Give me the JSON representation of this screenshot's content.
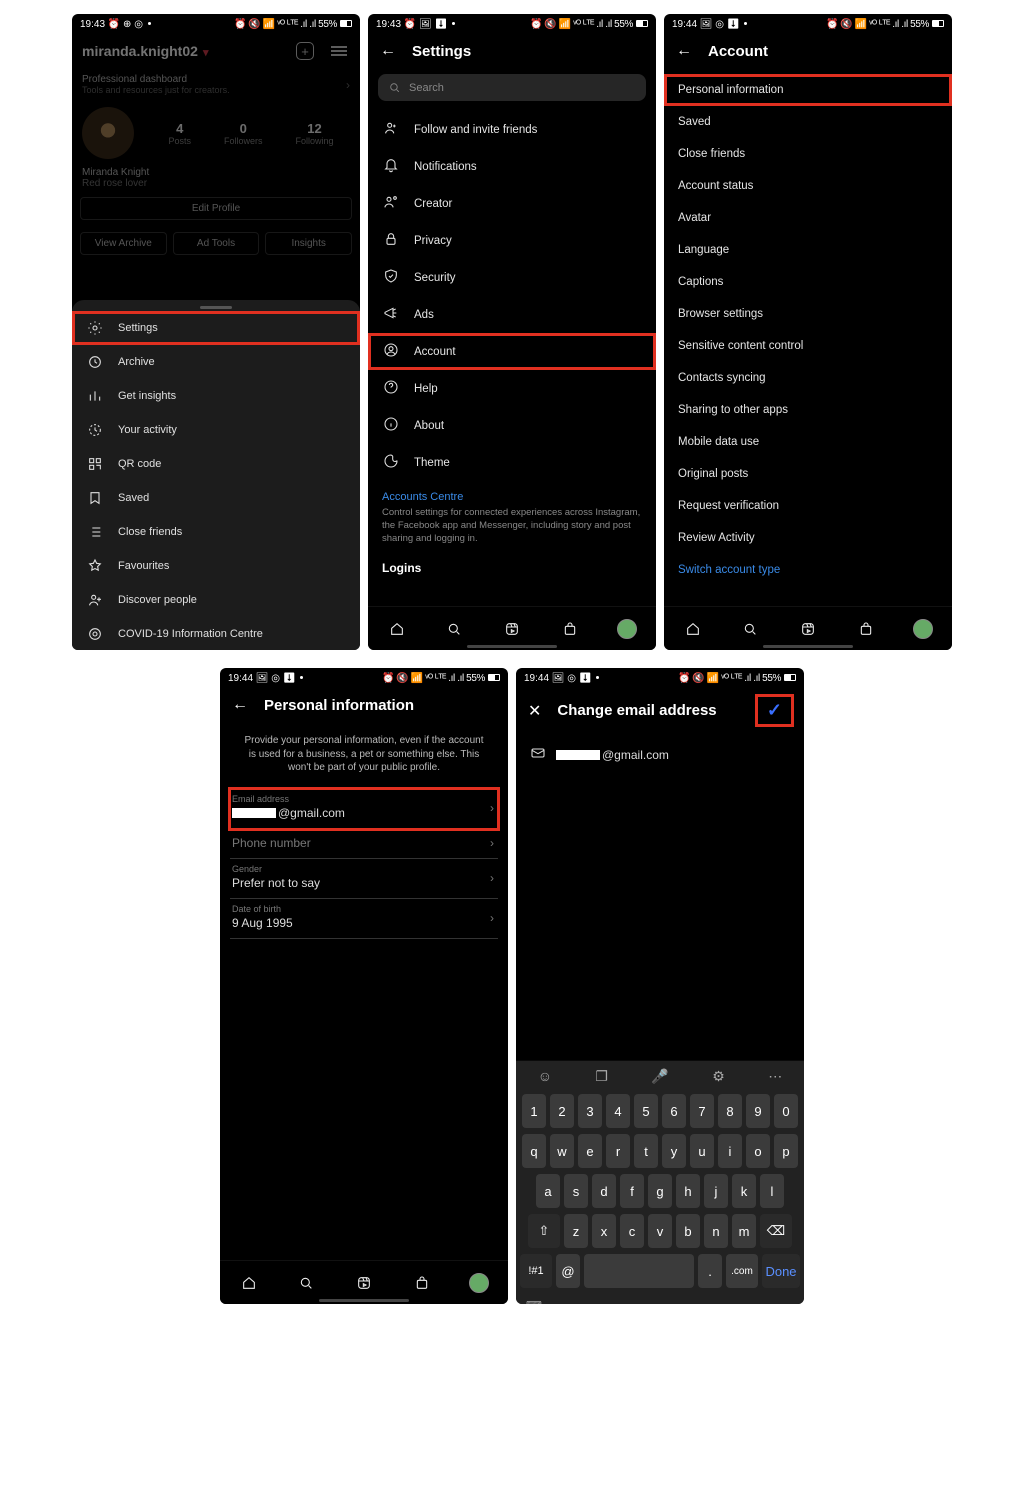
{
  "status": {
    "time1": "19:43",
    "time2": "19:44",
    "left_glyphs": "⏰ ⊕ ◎",
    "left_glyphs2": "🖼 ◎ ⬇",
    "right": "⏰ 🔇 📶 ᵛᴼ ᴸᵀᴱ .ıl .ıl 55%"
  },
  "screen1": {
    "username": "miranda.knight02",
    "dash_title": "Professional dashboard",
    "dash_sub": "Tools and resources just for creators.",
    "posts": {
      "n": "4",
      "l": "Posts"
    },
    "followers": {
      "n": "0",
      "l": "Followers"
    },
    "following": {
      "n": "12",
      "l": "Following"
    },
    "name": "Miranda Knight",
    "bio": "Red rose lover",
    "edit": "Edit Profile",
    "btns": [
      "View Archive",
      "Ad Tools",
      "Insights"
    ],
    "menu": [
      "Settings",
      "Archive",
      "Get insights",
      "Your activity",
      "QR code",
      "Saved",
      "Close friends",
      "Favourites",
      "Discover people",
      "COVID-19 Information Centre"
    ]
  },
  "screen2": {
    "title": "Settings",
    "search": "Search",
    "items": [
      "Follow and invite friends",
      "Notifications",
      "Creator",
      "Privacy",
      "Security",
      "Ads",
      "Account",
      "Help",
      "About",
      "Theme"
    ],
    "ac_title": "Accounts Centre",
    "ac_text": "Control settings for connected experiences across Instagram, the Facebook app and Messenger, including story and post sharing and logging in.",
    "logins": "Logins"
  },
  "screen3": {
    "title": "Account",
    "items": [
      "Personal information",
      "Saved",
      "Close friends",
      "Account status",
      "Avatar",
      "Language",
      "Captions",
      "Browser settings",
      "Sensitive content control",
      "Contacts syncing",
      "Sharing to other apps",
      "Mobile data use",
      "Original posts",
      "Request verification",
      "Review Activity"
    ],
    "switch": "Switch account type"
  },
  "screen4": {
    "title": "Personal information",
    "info": "Provide your personal information, even if the account is used for a business, a pet or something else. This won't be part of your public profile.",
    "email_lab": "Email address",
    "email_suffix": "@gmail.com",
    "phone_lab": "Phone number",
    "gender_lab": "Gender",
    "gender_val": "Prefer not to say",
    "dob_lab": "Date of birth",
    "dob_val": "9 Aug 1995"
  },
  "screen5": {
    "title": "Change email address",
    "email_suffix": "@gmail.com",
    "kb": {
      "row1": [
        "1",
        "2",
        "3",
        "4",
        "5",
        "6",
        "7",
        "8",
        "9",
        "0"
      ],
      "row2": [
        "q",
        "w",
        "e",
        "r",
        "t",
        "y",
        "u",
        "i",
        "o",
        "p"
      ],
      "row3": [
        "a",
        "s",
        "d",
        "f",
        "g",
        "h",
        "j",
        "k",
        "l"
      ],
      "row4": [
        "⇧",
        "z",
        "x",
        "c",
        "v",
        "b",
        "n",
        "m",
        "⌫"
      ],
      "sym": "!#1",
      "at": "@",
      "dot": ".",
      "com": ".com",
      "done": "Done"
    }
  }
}
